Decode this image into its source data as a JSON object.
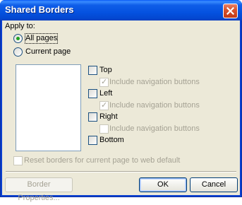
{
  "window": {
    "title": "Shared Borders"
  },
  "apply_to": {
    "label": "Apply to:",
    "options": [
      {
        "label": "All pages",
        "selected": true
      },
      {
        "label": "Current page",
        "selected": false
      }
    ]
  },
  "borders": {
    "top": {
      "label": "Top",
      "checked": false
    },
    "top_nav": {
      "label": "Include navigation buttons",
      "checked": true,
      "enabled": false
    },
    "left": {
      "label": "Left",
      "checked": false
    },
    "left_nav": {
      "label": "Include navigation buttons",
      "checked": true,
      "enabled": false
    },
    "right": {
      "label": "Right",
      "checked": false
    },
    "right_nav": {
      "label": "Include navigation buttons",
      "checked": false,
      "enabled": false
    },
    "bottom": {
      "label": "Bottom",
      "checked": false
    }
  },
  "reset": {
    "label": "Reset borders for current page to web default",
    "checked": false,
    "enabled": false
  },
  "buttons": {
    "border_properties": "Border Properties...",
    "ok": "OK",
    "cancel": "Cancel"
  },
  "colors": {
    "title_bar": "#0552e0",
    "client": "#ece9d8",
    "close": "#d9542e",
    "radio_dot": "#21a121"
  },
  "icons": {
    "close": "close-icon",
    "check": "check-icon"
  }
}
